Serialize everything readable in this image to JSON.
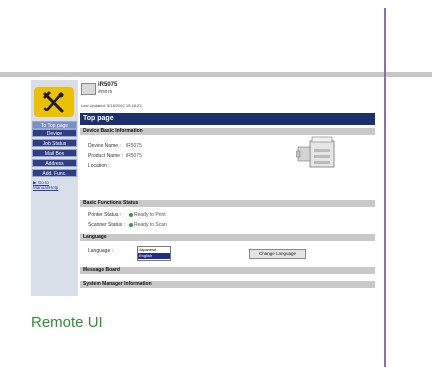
{
  "caption": "Remote UI",
  "sidebar": {
    "top_page_button": "To Top page",
    "items": [
      "Device",
      "Job Status",
      "Mail Box",
      "Address",
      "Add. Func."
    ],
    "manual_link": "▶ Go to Manual/Help"
  },
  "header": {
    "device_model": "iR5075",
    "device_name": "iR5075",
    "last_updated": "Last Updated: 5/18/2007 15:18:23"
  },
  "page_title": "Top page",
  "basic_info": {
    "heading": "Device Basic Information",
    "device_name_label": "Device Name :",
    "device_name_value": "iR5075",
    "product_name_label": "Product Name :",
    "product_name_value": "iR5075",
    "location_label": "Location :",
    "location_value": ""
  },
  "functions_status": {
    "heading": "Basic Functions Status",
    "printer_label": "Printer Status :",
    "printer_value": "Ready to Print",
    "scanner_label": "Scanner Status :",
    "scanner_value": "Ready to Scan",
    "status_color": "#3a9a3a"
  },
  "language": {
    "heading": "Language",
    "label": "Language :",
    "options": [
      "Japanese",
      "English"
    ],
    "selected": "English",
    "change_button": "Change Language"
  },
  "message_board": {
    "heading": "Message Board"
  },
  "system_manager": {
    "heading": "System Manager Information"
  },
  "colors": {
    "nav": "#2e3f87",
    "title_bar": "#1e2f6e",
    "caption": "#2f8f2f",
    "divider": "#8a6fb0",
    "logo": "#ecc100"
  }
}
